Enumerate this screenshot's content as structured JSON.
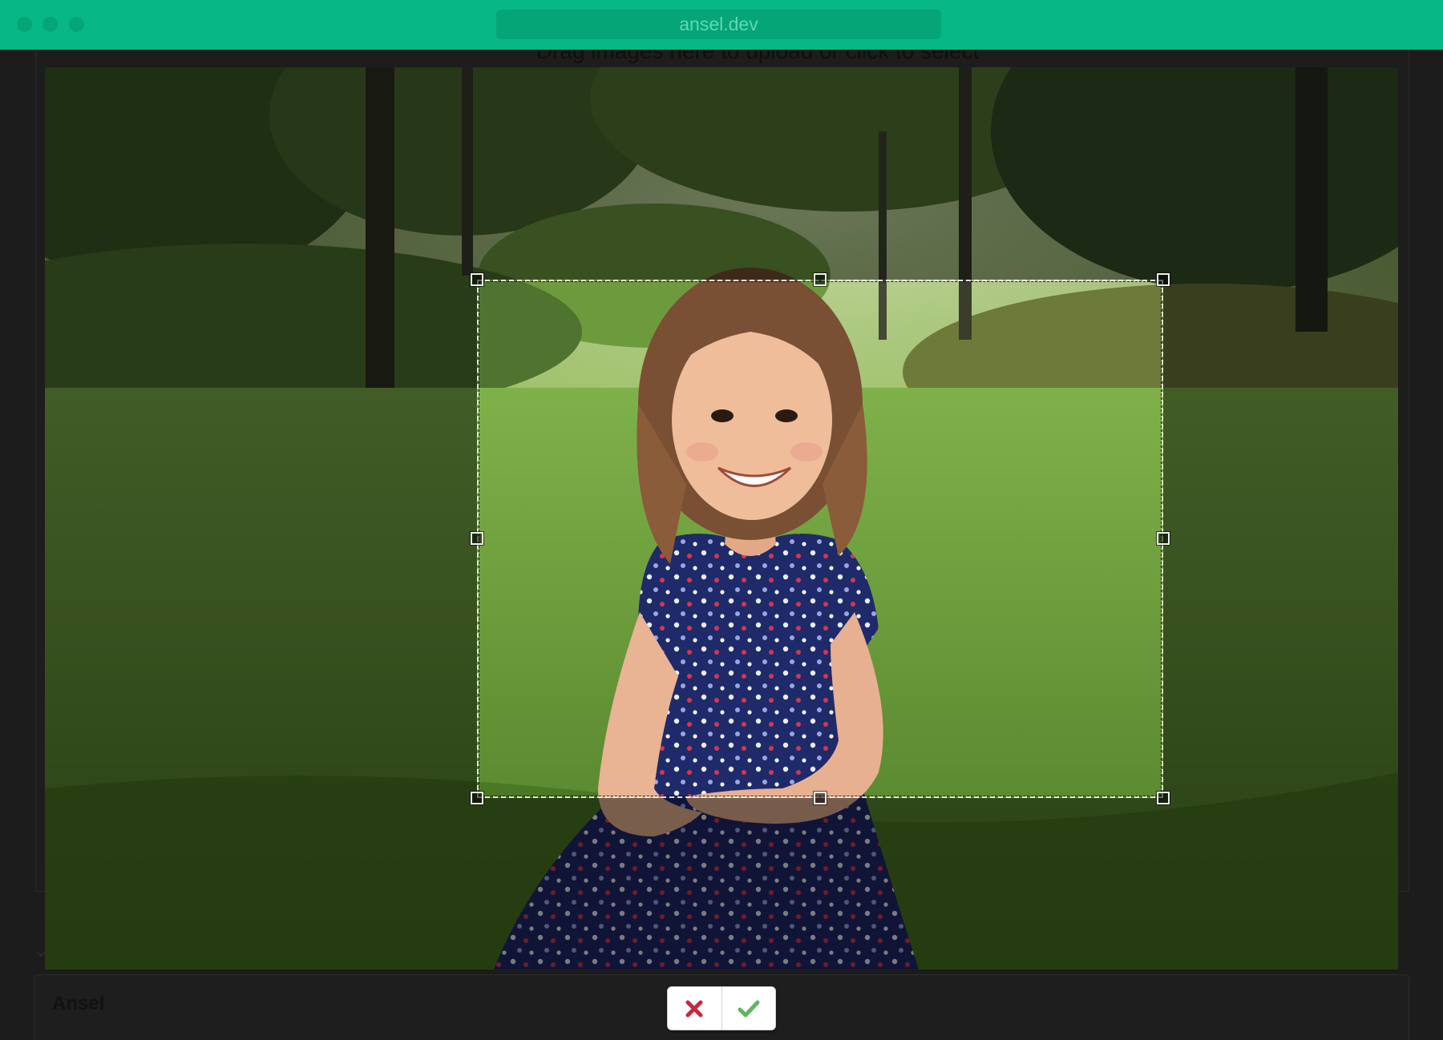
{
  "window": {
    "url": "ansel.dev"
  },
  "background_app": {
    "dropzone_text": "Drag images here to upload or click to select",
    "card_title": "Ansel"
  },
  "photo": {
    "description_icon": "portrait-photo"
  },
  "crop": {
    "handles": [
      "nw",
      "n",
      "ne",
      "w",
      "e",
      "sw",
      "s",
      "se"
    ]
  },
  "actions": {
    "cancel_icon": "x-icon",
    "confirm_icon": "check-icon"
  },
  "colors": {
    "accent": "#07b886",
    "cancel": "#c9283e",
    "confirm": "#5cb85c"
  }
}
